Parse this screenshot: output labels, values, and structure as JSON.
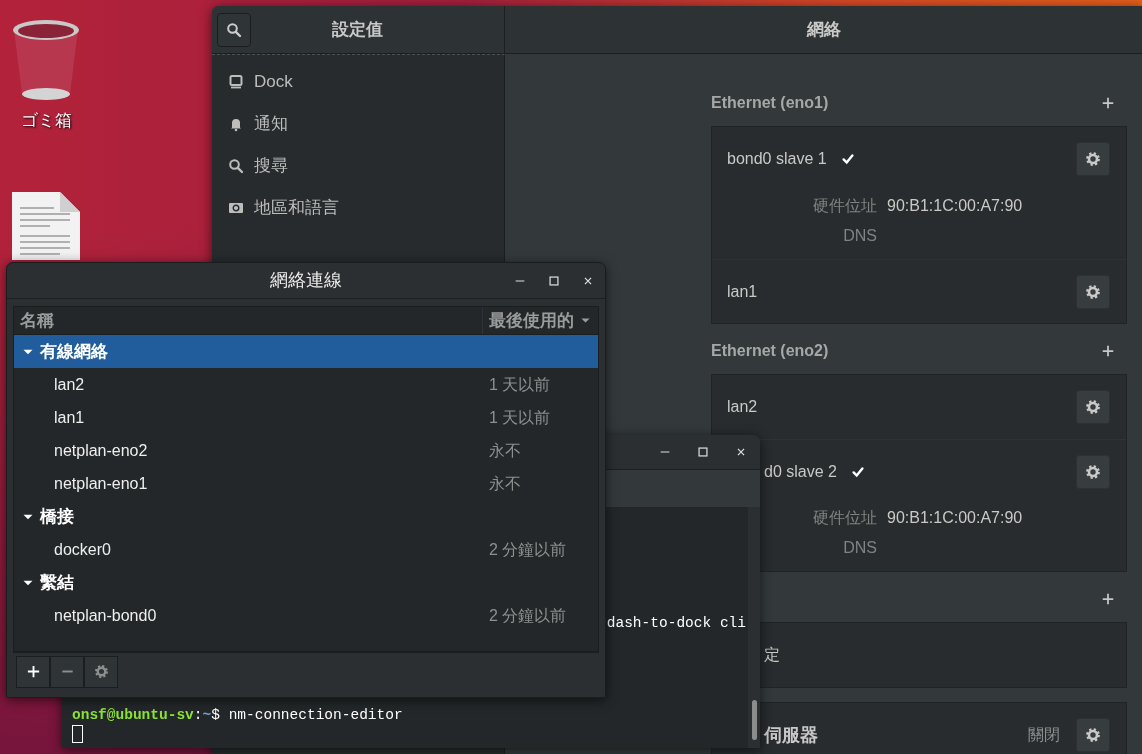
{
  "desktop": {
    "icons": [
      {
        "kind": "trash",
        "label": "ゴミ箱"
      },
      {
        "kind": "document"
      }
    ]
  },
  "settings": {
    "sidebar_title": "設定值",
    "title": "網絡",
    "sidebar_items": [
      {
        "label": "Dock",
        "kind": "dock"
      },
      {
        "label": "通知",
        "kind": "bell"
      },
      {
        "label": "搜尋",
        "kind": "search"
      },
      {
        "label": "地區和語言",
        "kind": "region"
      }
    ],
    "sections": [
      {
        "heading": "Ethernet (eno1)",
        "add_button": true,
        "rows": [
          {
            "kind": "connection",
            "name": "bond0 slave 1",
            "connected": true,
            "details": [
              {
                "label": "硬件位址",
                "value": "90:B1:1C:00:A7:90"
              },
              {
                "label": "DNS"
              }
            ]
          },
          {
            "kind": "connection",
            "name": "lan1",
            "connected": false
          }
        ]
      },
      {
        "heading": "Ethernet (eno2)",
        "add_button": true,
        "rows": [
          {
            "kind": "connection",
            "name": "lan2",
            "connected": false
          },
          {
            "kind": "connection",
            "name": "d0 slave 2",
            "connected": true,
            "details": [
              {
                "label": "硬件位址",
                "value": "90:B1:1C:00:A7:90"
              },
              {
                "label": "DNS"
              }
            ]
          }
        ]
      },
      {
        "add_button": true,
        "rows": [
          {
            "kind": "plain",
            "name": "定"
          }
        ]
      },
      {
        "add_button": false,
        "rows": [
          {
            "kind": "proxy",
            "name": "伺服器",
            "status": "關閉"
          }
        ]
      }
    ]
  },
  "terminal": {
    "lines": [
      {
        "kind": "output",
        "text": "dash-to-dock cli"
      },
      {
        "kind": "prompt",
        "user": "onsf@ubuntu-sv",
        "sep": ":",
        "path": "~",
        "symbol": "$",
        "command": "nm-connection-editor"
      }
    ],
    "cursor": true
  },
  "connections_window": {
    "title": "網絡連線",
    "columns": [
      {
        "label": "名稱",
        "sorted": false
      },
      {
        "label": "最後使用的",
        "sorted": true
      }
    ],
    "groups": [
      {
        "name": "有線網絡",
        "expanded": true,
        "selected": true,
        "connections": [
          {
            "name": "lan2",
            "last_used": "1 天以前"
          },
          {
            "name": "lan1",
            "last_used": "1 天以前"
          },
          {
            "name": "netplan-eno2",
            "last_used": "永不"
          },
          {
            "name": "netplan-eno1",
            "last_used": "永不"
          }
        ]
      },
      {
        "name": "橋接",
        "expanded": true,
        "selected": false,
        "connections": [
          {
            "name": "docker0",
            "last_used": "2 分鐘以前"
          }
        ]
      },
      {
        "name": "繫結",
        "expanded": true,
        "selected": false,
        "connections": [
          {
            "name": "netplan-bond0",
            "last_used": "2 分鐘以前"
          }
        ]
      }
    ],
    "toolbar": [
      {
        "kind": "add",
        "disabled": false
      },
      {
        "kind": "remove",
        "disabled": true
      },
      {
        "kind": "settings",
        "disabled": true
      }
    ]
  }
}
